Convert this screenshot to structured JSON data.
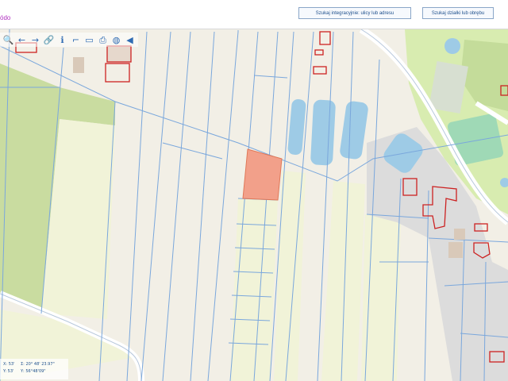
{
  "header": {
    "link_text": "ódo",
    "buttons": [
      {
        "label": "Szukaj integracyjnie: ulicy lub adresu"
      },
      {
        "label": "Szukaj działki lub obrębu"
      }
    ]
  },
  "toolbar": {
    "tools": [
      {
        "name": "zoom-tool-icon",
        "glyph": "🔍"
      },
      {
        "name": "back-arrow-icon",
        "glyph": "←"
      },
      {
        "name": "forward-arrow-icon",
        "glyph": "→"
      },
      {
        "name": "link-icon",
        "glyph": "🔗"
      },
      {
        "name": "info-icon",
        "glyph": "ℹ"
      },
      {
        "name": "measure-line-icon",
        "glyph": "⌐"
      },
      {
        "name": "measure-area-icon",
        "glyph": "▭"
      },
      {
        "name": "print-icon",
        "glyph": "⎙"
      },
      {
        "name": "globe-icon",
        "glyph": "◍"
      },
      {
        "name": "audio-icon",
        "glyph": "◀"
      }
    ]
  },
  "coordinates": {
    "x_label": "X: ",
    "x_value": "53'",
    "y_label": "Y: ",
    "y_value": "53'",
    "lat_label": "Σ:",
    "lat_value": "20° 48' 23.97\"",
    "lon_label": "Υ:",
    "lon_value": "56°48'09\""
  },
  "map": {
    "colors": {
      "background": "#f2efe6",
      "parcel_line": "#7aa7dc",
      "building": "#cc2222",
      "highlight": "#f2a08a",
      "water": "#9ecbe6",
      "grass": "#d8ecb0",
      "field": "#f1f3d8",
      "road": "#ffffff",
      "forest": "#c9dca0"
    }
  }
}
